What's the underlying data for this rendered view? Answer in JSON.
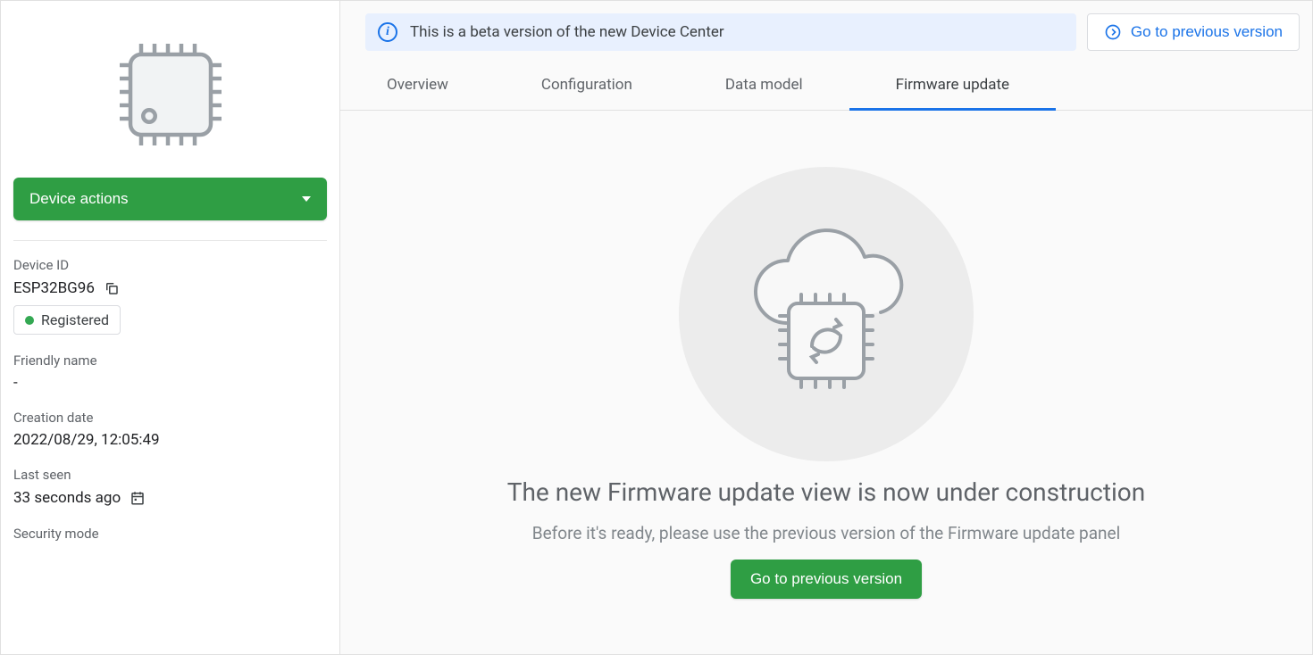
{
  "sidebar": {
    "device_actions_label": "Device actions",
    "device_id_label": "Device ID",
    "device_id_value": "ESP32BG96",
    "status_label": "Registered",
    "friendly_name_label": "Friendly name",
    "friendly_name_value": "-",
    "creation_date_label": "Creation date",
    "creation_date_value": "2022/08/29, 12:05:49",
    "last_seen_label": "Last seen",
    "last_seen_value": "33 seconds ago",
    "security_mode_label": "Security mode"
  },
  "banner": {
    "message": "This is a beta version of the new Device Center",
    "previous_link": "Go to previous version"
  },
  "tabs": {
    "overview": "Overview",
    "configuration": "Configuration",
    "data_model": "Data model",
    "firmware_update": "Firmware update"
  },
  "content": {
    "heading": "The new Firmware update view is now under construction",
    "subheading": "Before it's ready, please use the previous version of the Firmware update panel",
    "cta": "Go to previous version"
  }
}
